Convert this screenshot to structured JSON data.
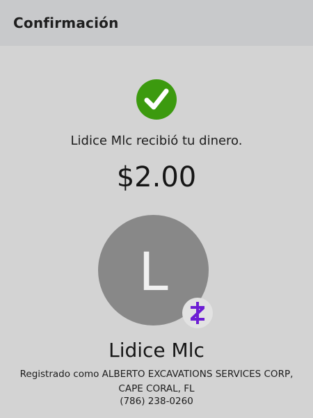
{
  "header": {
    "title": "Confirmación"
  },
  "confirmation": {
    "status_icon": "check-circle-icon",
    "message": "Lidice Mlc recibió tu dinero.",
    "amount": "$2.00"
  },
  "recipient": {
    "initial": "L",
    "name": "Lidice Mlc",
    "registered_as": "Registrado como ALBERTO EXCAVATIONS SERVICES CORP, CAPE CORAL, FL",
    "phone": "(786) 238-0260",
    "badge_icon": "zelle-logo-icon"
  },
  "colors": {
    "header_bg": "#c8c9cb",
    "page_bg": "#d3d3d3",
    "success_green": "#3c9a0f",
    "avatar_gray": "#888888",
    "zelle_purple": "#6d1ed4"
  }
}
